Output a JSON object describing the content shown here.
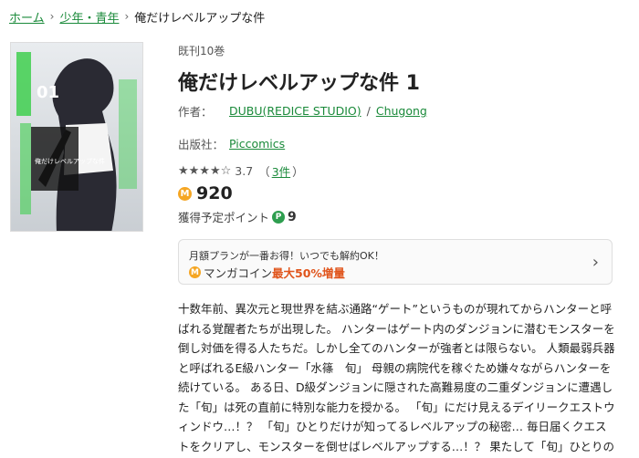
{
  "breadcrumb": {
    "items": [
      "ホーム",
      "少年・青年"
    ],
    "separator": "›",
    "current": "俺だけレベルアップな件"
  },
  "cover": {
    "volume_text": "01",
    "title_text": "俺だけレベルアップな件",
    "alt": "俺だけレベルアップな件 1"
  },
  "book": {
    "count": "既刊10巻",
    "title": "俺だけレベルアップな件 1",
    "author_label": "作者：",
    "authors": [
      "DUBU(REDICE STUDIO)",
      "Chugong"
    ],
    "author_separator": "/",
    "publisher_label": "出版社：",
    "publisher": "Piccomics",
    "rating": {
      "stars_text": "★★★★☆",
      "value_text": "3.7",
      "open_paren": "（",
      "reviews_link": "3件",
      "close_paren": "）",
      "value": 3.7
    },
    "price": {
      "coin_icon": "M",
      "value": "920"
    },
    "points": {
      "label": "獲得予定ポイント",
      "icon": "P",
      "value": "9"
    }
  },
  "promo": {
    "line1": "月額プランが一番お得！いつでも解約OK！",
    "coin_icon": "M",
    "prefix": "マンガコイン",
    "highlight": "最大50%増量",
    "chevron": "›"
  },
  "description": "十数年前、異次元と現世界を結ぶ通路“ゲート”というものが現れてからハンターと呼ばれる覚醒者たちが出現した。 ハンターはゲート内のダンジョンに潜むモンスターを倒し対価を得る人たちだ。しかし全てのハンターが強者とは限らない。 人類最弱兵器と呼ばれるE級ハンター「水篠　旬」 母親の病院代を稼ぐため嫌々ながらハンターを続けている。 ある日、D級ダンジョンに隠された高難易度の二重ダンジョンに遭遇した「旬」は死の直前に特別な能力を授かる。 「旬」にだけ見えるデイリークエストウィンドウ…！？ 「旬」ひとりだけが知ってるレベルアップの秘密… 毎日届くクエストをクリアし、モンスターを倒せばレベルアップする…！？ 果たして「旬」ひとりのレベルアップはどこまで続くのかーー！！",
  "colors": {
    "link_green": "#1a8a3a",
    "coin_orange": "#f5a623",
    "point_green": "#2e9e4f",
    "promo_orange": "#e0541b"
  }
}
